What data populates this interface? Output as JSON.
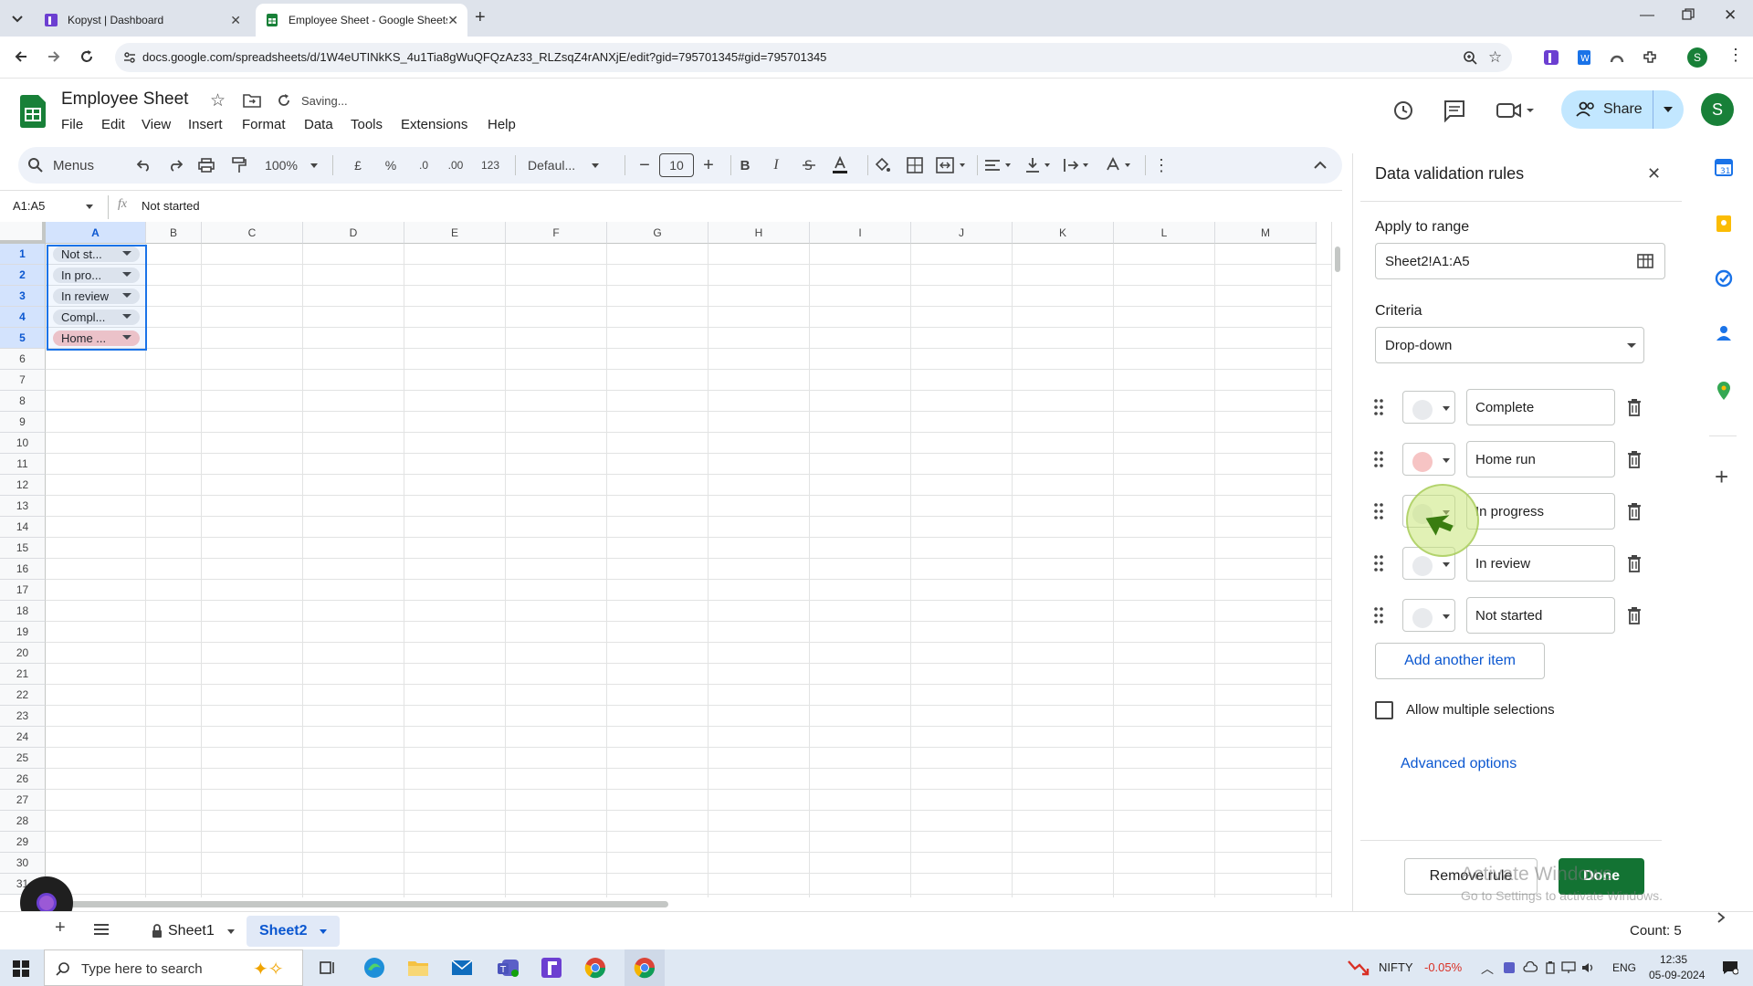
{
  "browser": {
    "tabs": [
      {
        "title": "Kopyst | Dashboard",
        "icon": "kopyst-icon"
      },
      {
        "title": "Employee Sheet - Google Sheets",
        "icon": "sheets-icon"
      }
    ],
    "url": "docs.google.com/spreadsheets/d/1W4eUTINkKS_4u1Tia8gWuQFQzAz33_RLZsqZ4rANXjE/edit?gid=795701345#gid=795701345",
    "profile_initial": "S"
  },
  "doc": {
    "title": "Employee Sheet",
    "status": "Saving...",
    "menus": [
      "File",
      "Edit",
      "View",
      "Insert",
      "Format",
      "Data",
      "Tools",
      "Extensions",
      "Help"
    ],
    "share_label": "Share",
    "account_initial": "S"
  },
  "toolbar": {
    "menus_label": "Menus",
    "zoom": "100%",
    "currency": "£",
    "percent": "%",
    "dec_decrease": ".0",
    "dec_increase": ".00",
    "number_format": "123",
    "font": "Defaul...",
    "font_size": "10",
    "bold": "B",
    "italic": "I"
  },
  "formula_bar": {
    "name_box": "A1:A5",
    "fx": "fx",
    "value": "Not started"
  },
  "grid": {
    "columns": [
      "A",
      "B",
      "C",
      "D",
      "E",
      "F",
      "G",
      "H",
      "I",
      "J",
      "K",
      "L",
      "M"
    ],
    "rows": [
      "1",
      "2",
      "3",
      "4",
      "5",
      "6",
      "7",
      "8",
      "9",
      "10",
      "11",
      "12",
      "13",
      "14",
      "15",
      "16",
      "17",
      "18",
      "19",
      "20",
      "21",
      "22",
      "23",
      "24",
      "25",
      "26",
      "27",
      "28",
      "29",
      "30",
      "31"
    ],
    "cells": [
      {
        "text": "Not st...",
        "color": "#e8eaed"
      },
      {
        "text": "In pro...",
        "color": "#e8eaed"
      },
      {
        "text": "In review",
        "color": "#e8eaed"
      },
      {
        "text": "Compl...",
        "color": "#e8eaed"
      },
      {
        "text": "Home ...",
        "color": "#f8c7c7"
      }
    ]
  },
  "sheets": {
    "tabs": [
      "Sheet1",
      "Sheet2"
    ],
    "active": "Sheet2",
    "count": "Count: 5"
  },
  "panel": {
    "title": "Data validation rules",
    "apply_label": "Apply to range",
    "range": "Sheet2!A1:A5",
    "criteria_label": "Criteria",
    "criteria_value": "Drop-down",
    "items": [
      {
        "value": "Complete",
        "color": "#e8eaed"
      },
      {
        "value": "Home run",
        "color": "#f6c4c4"
      },
      {
        "value": "In progress",
        "color": "#e8eaed"
      },
      {
        "value": "In review",
        "color": "#e8eaed"
      },
      {
        "value": "Not started",
        "color": "#e8eaed"
      }
    ],
    "add_item": "Add another item",
    "allow_multiple": "Allow multiple selections",
    "advanced": "Advanced options",
    "remove_rule": "Remove rule",
    "done": "Done",
    "watermark_line1": "Activate Windows",
    "watermark_line2": "Go to Settings to activate Windows."
  },
  "taskbar": {
    "search_placeholder": "Type here to search",
    "ticker": "NIFTY",
    "ticker_change": "-0.05%",
    "lang": "ENG",
    "time": "12:35",
    "date": "05-09-2024"
  },
  "colors": {
    "accent": "#0b57d0",
    "sheets_green": "#188038",
    "done_green": "#137333",
    "ticker_red": "#d93025"
  }
}
